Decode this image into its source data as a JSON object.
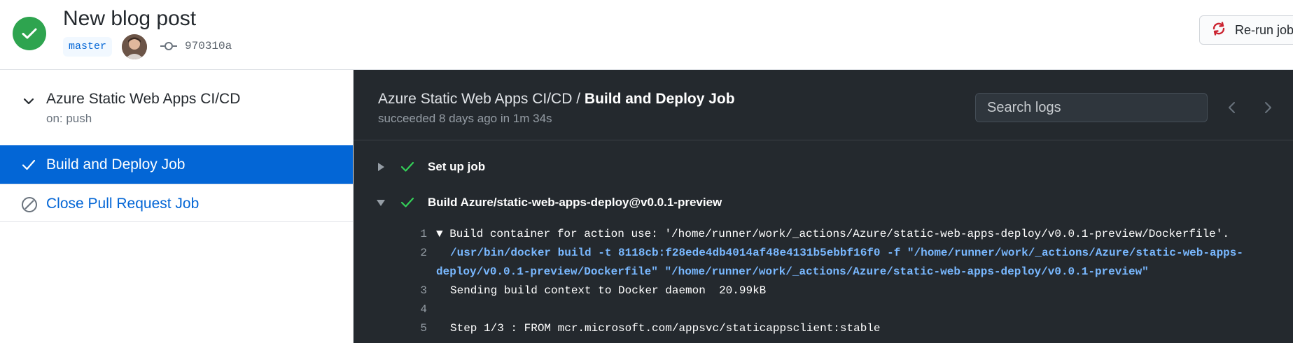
{
  "header": {
    "title": "New blog post",
    "branch": "master",
    "commit_sha": "970310a",
    "rerun_label": "Re-run jobs",
    "status_color": "#2ea44f"
  },
  "sidebar": {
    "workflow_name": "Azure Static Web Apps CI/CD",
    "workflow_trigger": "on: push",
    "jobs": [
      {
        "label": "Build and Deploy Job",
        "status": "success",
        "icon": "check-icon",
        "selected": true
      },
      {
        "label": "Close Pull Request Job",
        "status": "skipped",
        "icon": "skip-icon",
        "selected": false
      }
    ]
  },
  "logs": {
    "workflow_name": "Azure Static Web Apps CI/CD",
    "separator": " / ",
    "job_name": "Build and Deploy Job",
    "subtitle": "succeeded 8 days ago in 1m 34s",
    "search_placeholder": "Search logs",
    "steps": [
      {
        "label": "Set up job",
        "expanded": false,
        "status": "success"
      },
      {
        "label": "Build Azure/static-web-apps-deploy@v0.0.1-preview",
        "expanded": true,
        "status": "success"
      }
    ],
    "lines": [
      {
        "num": "1",
        "text": "Build container for action use: '/home/runner/work/_actions/Azure/static-web-apps-deploy/v0.0.1-preview/Dockerfile'."
      },
      {
        "num": "2",
        "text": "/usr/bin/docker build -t 8118cb:f28ede4db4014af48e4131b5ebbf16f0 -f \"/home/runner/work/_actions/Azure/static-web-apps-",
        "text2": "deploy/v0.0.1-preview/Dockerfile\" \"/home/runner/work/_actions/Azure/static-web-apps-deploy/v0.0.1-preview\""
      },
      {
        "num": "3",
        "text": "Sending build context to Docker daemon  20.99kB"
      },
      {
        "num": "4",
        "text": ""
      },
      {
        "num": "5",
        "text": "Step 1/3 : FROM mcr.microsoft.com/appsvc/staticappsclient:stable"
      }
    ]
  },
  "colors": {
    "success": "#2ea44f",
    "link": "#0366d6",
    "log_bg": "#24292e",
    "command": "#79b8ff"
  }
}
